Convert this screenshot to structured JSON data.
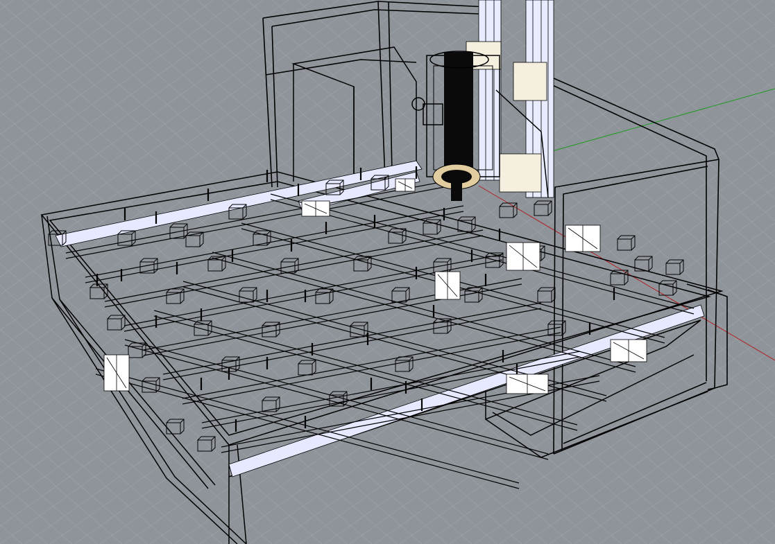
{
  "viewport": {
    "kind": "perspective-wireframe-viewport",
    "colors": {
      "background": "#8f949a",
      "grid_line": "#9da2a8",
      "wire": "#000000",
      "selected_fill": "#ffffff",
      "x_axis": "#b02020",
      "y_axis": "#1f9a1f",
      "rail_fill": "#e6e9ff",
      "bearing_ring": "#e2cda0"
    },
    "objects": [
      {
        "name": "machine-base-frame"
      },
      {
        "name": "gantry-bridge"
      },
      {
        "name": "z-axis-column"
      },
      {
        "name": "spindle-motor"
      },
      {
        "name": "linear-rails"
      },
      {
        "name": "table-beams"
      },
      {
        "name": "carriage-blocks"
      }
    ]
  }
}
